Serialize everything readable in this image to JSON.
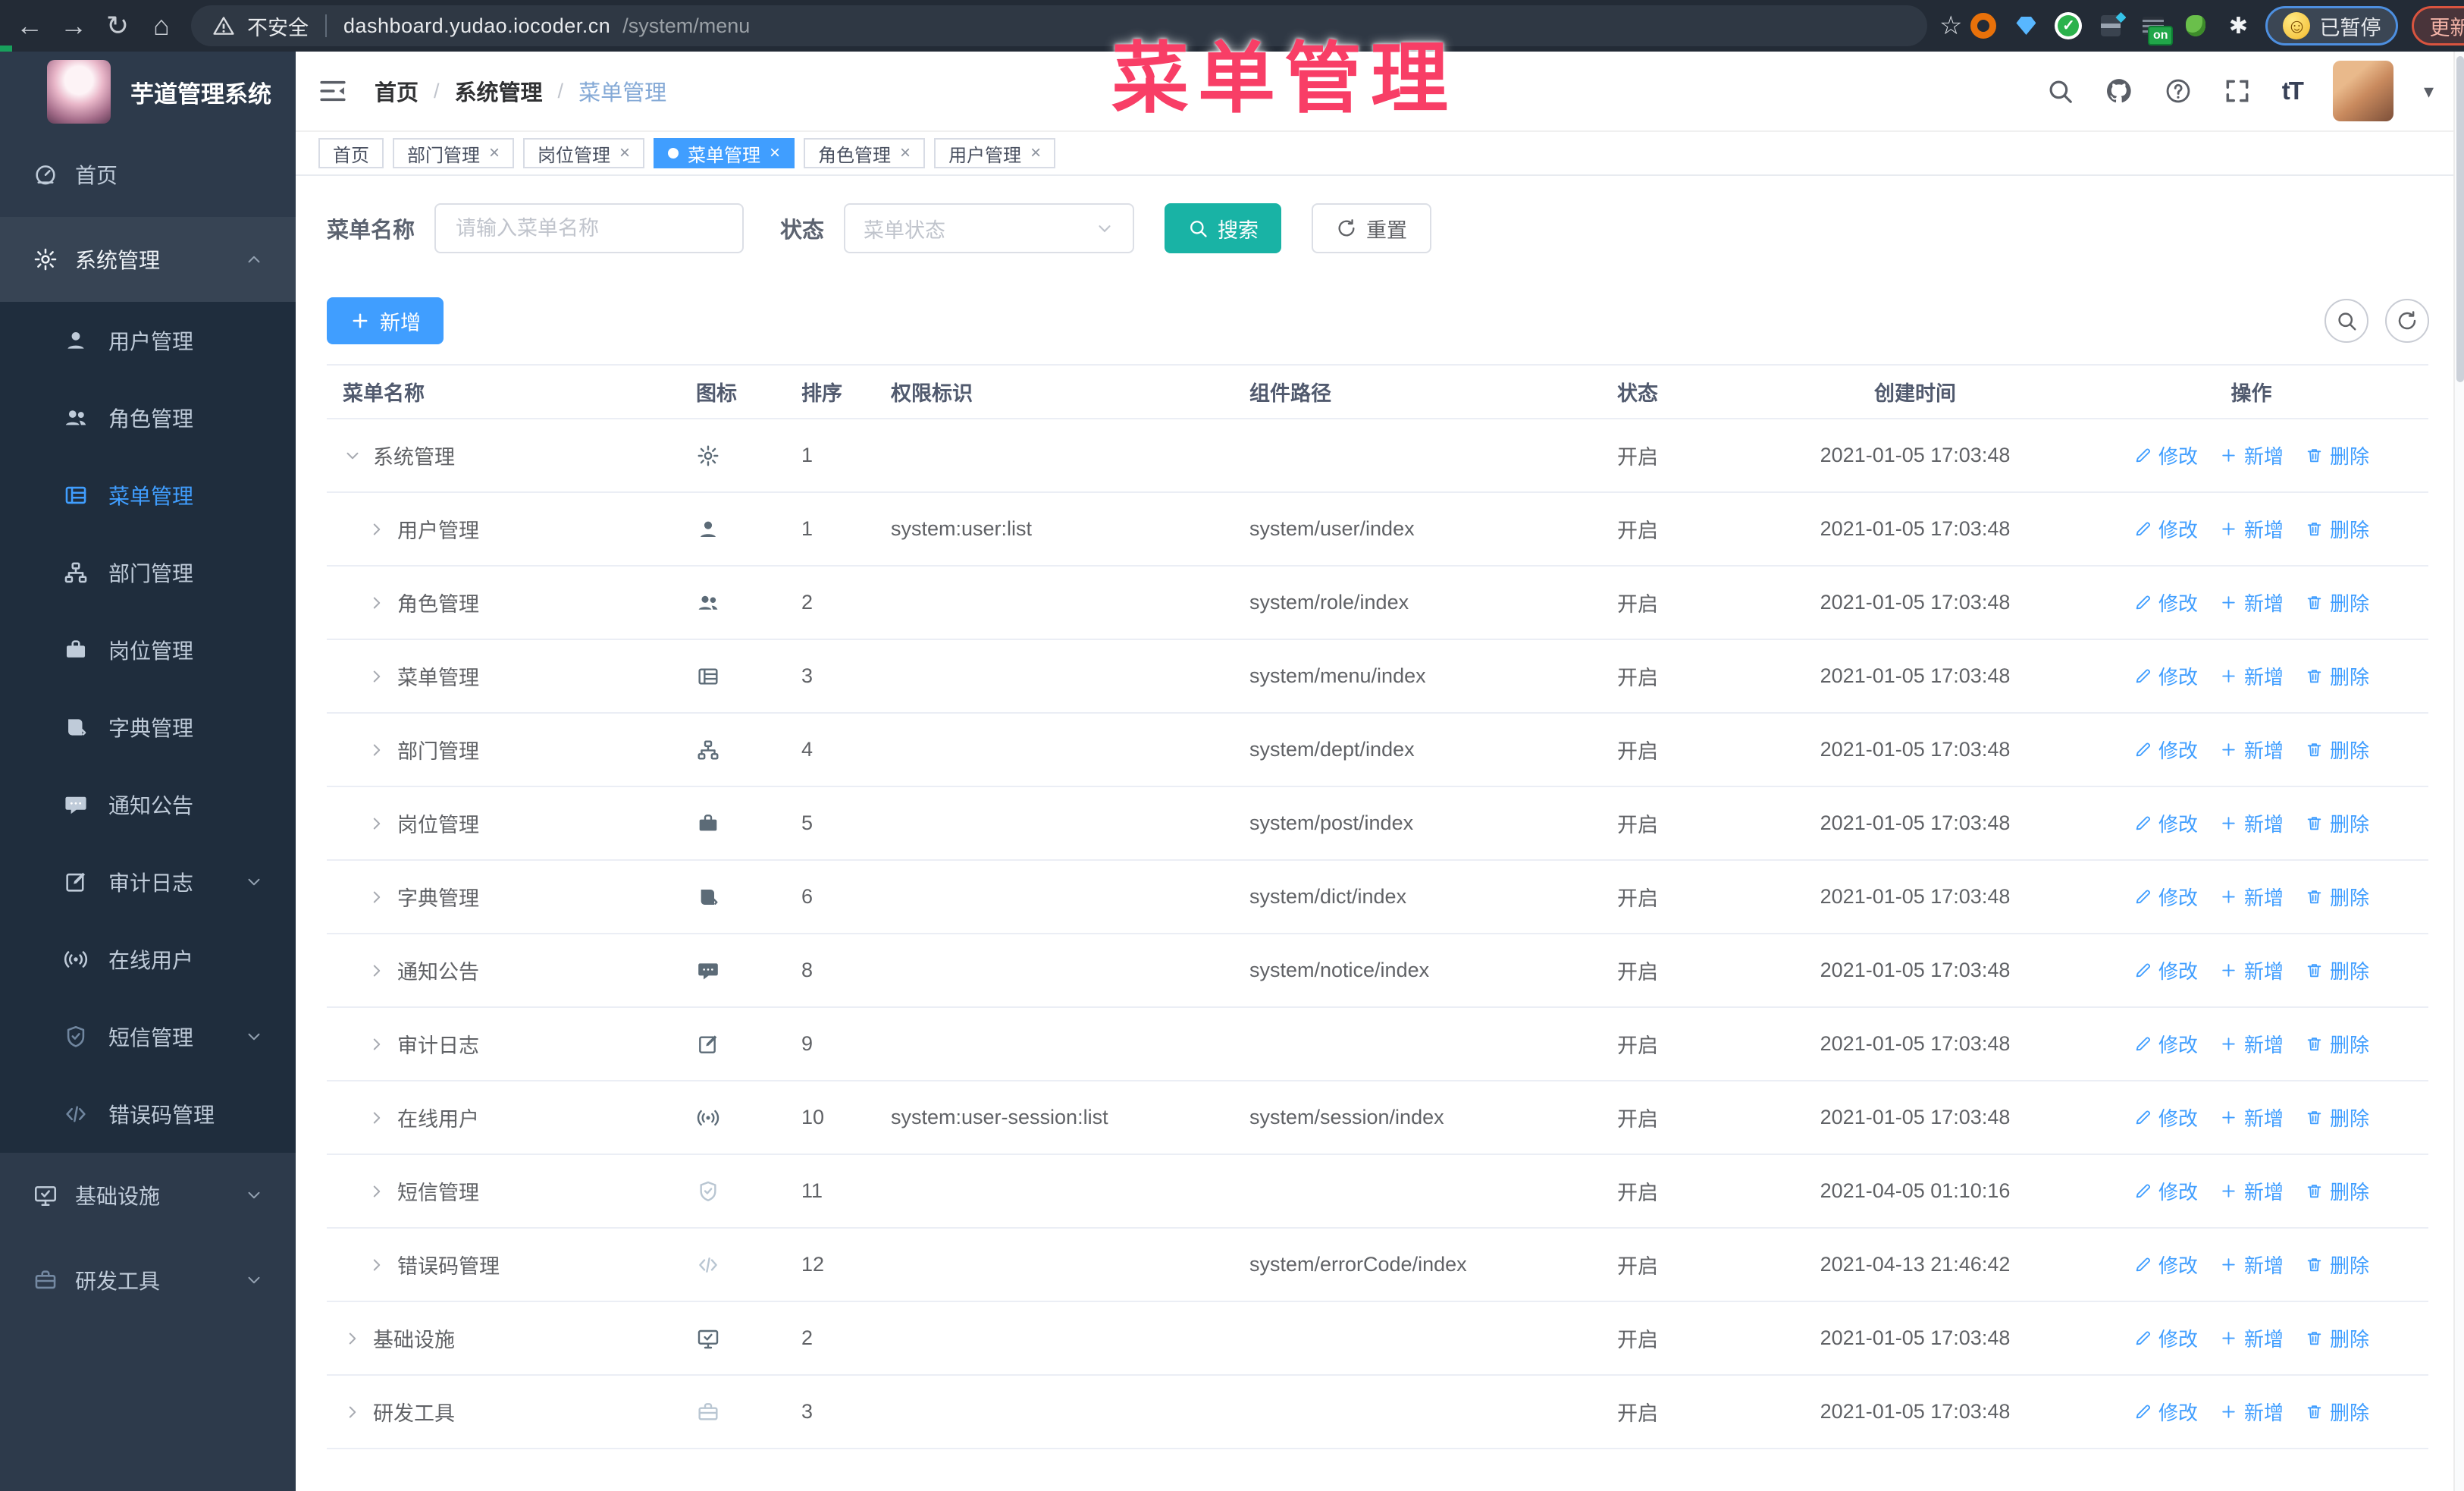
{
  "colors": {
    "primary": "#409eff",
    "search_button": "#19b3a5",
    "sidebar_bg": "#2d3a4b",
    "submenu_bg": "#1f2d3d",
    "active_tag": "#409eff",
    "overlay_pink": "#f83e66",
    "chrome_bar": "#232b36"
  },
  "browser": {
    "security_label": "不安全",
    "url_host": "dashboard.yudao.iocoder.cn",
    "url_path": "/system/menu",
    "paused_label": "已暂停",
    "update_label": "更新",
    "on_badge": "on",
    "extension_icons": [
      "orange-ring-icon",
      "blue-gem-icon",
      "green-check-icon",
      "gray-squares-icon",
      "dark-on-badge-icon",
      "green-frog-icon",
      "white-puzzle-icon"
    ]
  },
  "overlay_title": "菜单管理",
  "sidebar": {
    "app_title": "芋道管理系统",
    "items": [
      {
        "label": "首页",
        "icon": "dashboard"
      },
      {
        "label": "系统管理",
        "icon": "gear",
        "expanded": true,
        "active": true,
        "children": [
          {
            "label": "用户管理",
            "icon": "user"
          },
          {
            "label": "角色管理",
            "icon": "users"
          },
          {
            "label": "菜单管理",
            "icon": "menu-list",
            "active": true
          },
          {
            "label": "部门管理",
            "icon": "tree"
          },
          {
            "label": "岗位管理",
            "icon": "briefcase"
          },
          {
            "label": "字典管理",
            "icon": "book"
          },
          {
            "label": "通知公告",
            "icon": "message"
          },
          {
            "label": "审计日志",
            "icon": "edit",
            "collapsed": true
          },
          {
            "label": "在线用户",
            "icon": "headset"
          },
          {
            "label": "短信管理",
            "icon": "shield",
            "collapsed": true,
            "muted": true
          },
          {
            "label": "错误码管理",
            "icon": "code",
            "muted": true
          }
        ]
      },
      {
        "label": "基础设施",
        "icon": "monitor",
        "collapsed": true
      },
      {
        "label": "研发工具",
        "icon": "toolbox",
        "collapsed": true,
        "muted": true
      }
    ]
  },
  "navbar": {
    "breadcrumb": [
      "首页",
      "系统管理",
      "菜单管理"
    ],
    "font_size_label": "tT"
  },
  "tags": [
    {
      "label": "首页",
      "closable": false,
      "active": false
    },
    {
      "label": "部门管理",
      "closable": true,
      "active": false
    },
    {
      "label": "岗位管理",
      "closable": true,
      "active": false
    },
    {
      "label": "菜单管理",
      "closable": true,
      "active": true
    },
    {
      "label": "角色管理",
      "closable": true,
      "active": false
    },
    {
      "label": "用户管理",
      "closable": true,
      "active": false
    }
  ],
  "search": {
    "name_label": "菜单名称",
    "name_placeholder": "请输入菜单名称",
    "name_value": "",
    "status_label": "状态",
    "status_placeholder": "菜单状态",
    "search_button": "搜索",
    "reset_button": "重置"
  },
  "toolbar": {
    "add_label": "新增"
  },
  "table": {
    "headers": [
      "菜单名称",
      "图标",
      "排序",
      "权限标识",
      "组件路径",
      "状态",
      "创建时间",
      "操作"
    ],
    "action_labels": {
      "edit": "修改",
      "add": "新增",
      "delete": "删除"
    },
    "rows": [
      {
        "name": "系统管理",
        "icon": "gear",
        "level": 0,
        "expanded": true,
        "order": "1",
        "perm": "",
        "path": "",
        "status": "开启",
        "time": "2021-01-05 17:03:48"
      },
      {
        "name": "用户管理",
        "icon": "user",
        "level": 1,
        "expanded": false,
        "order": "1",
        "perm": "system:user:list",
        "path": "system/user/index",
        "status": "开启",
        "time": "2021-01-05 17:03:48"
      },
      {
        "name": "角色管理",
        "icon": "users",
        "level": 1,
        "expanded": false,
        "order": "2",
        "perm": "",
        "path": "system/role/index",
        "status": "开启",
        "time": "2021-01-05 17:03:48"
      },
      {
        "name": "菜单管理",
        "icon": "menu-list",
        "level": 1,
        "expanded": false,
        "order": "3",
        "perm": "",
        "path": "system/menu/index",
        "status": "开启",
        "time": "2021-01-05 17:03:48"
      },
      {
        "name": "部门管理",
        "icon": "tree",
        "level": 1,
        "expanded": false,
        "order": "4",
        "perm": "",
        "path": "system/dept/index",
        "status": "开启",
        "time": "2021-01-05 17:03:48"
      },
      {
        "name": "岗位管理",
        "icon": "briefcase",
        "level": 1,
        "expanded": false,
        "order": "5",
        "perm": "",
        "path": "system/post/index",
        "status": "开启",
        "time": "2021-01-05 17:03:48"
      },
      {
        "name": "字典管理",
        "icon": "book",
        "level": 1,
        "expanded": false,
        "order": "6",
        "perm": "",
        "path": "system/dict/index",
        "status": "开启",
        "time": "2021-01-05 17:03:48"
      },
      {
        "name": "通知公告",
        "icon": "message",
        "level": 1,
        "expanded": false,
        "order": "8",
        "perm": "",
        "path": "system/notice/index",
        "status": "开启",
        "time": "2021-01-05 17:03:48"
      },
      {
        "name": "审计日志",
        "icon": "edit",
        "level": 1,
        "expanded": false,
        "order": "9",
        "perm": "",
        "path": "",
        "status": "开启",
        "time": "2021-01-05 17:03:48"
      },
      {
        "name": "在线用户",
        "icon": "headset",
        "level": 1,
        "expanded": false,
        "order": "10",
        "perm": "system:user-session:list",
        "path": "system/session/index",
        "status": "开启",
        "time": "2021-01-05 17:03:48"
      },
      {
        "name": "短信管理",
        "icon": "shield",
        "level": 1,
        "expanded": false,
        "order": "11",
        "perm": "",
        "path": "",
        "status": "开启",
        "time": "2021-04-05 01:10:16",
        "muted": true
      },
      {
        "name": "错误码管理",
        "icon": "code",
        "level": 1,
        "expanded": false,
        "order": "12",
        "perm": "",
        "path": "system/errorCode/index",
        "status": "开启",
        "time": "2021-04-13 21:46:42",
        "muted": true
      },
      {
        "name": "基础设施",
        "icon": "monitor",
        "level": 0,
        "expanded": false,
        "order": "2",
        "perm": "",
        "path": "",
        "status": "开启",
        "time": "2021-01-05 17:03:48"
      },
      {
        "name": "研发工具",
        "icon": "toolbox",
        "level": 0,
        "expanded": false,
        "order": "3",
        "perm": "",
        "path": "",
        "status": "开启",
        "time": "2021-01-05 17:03:48",
        "muted": true
      }
    ]
  }
}
